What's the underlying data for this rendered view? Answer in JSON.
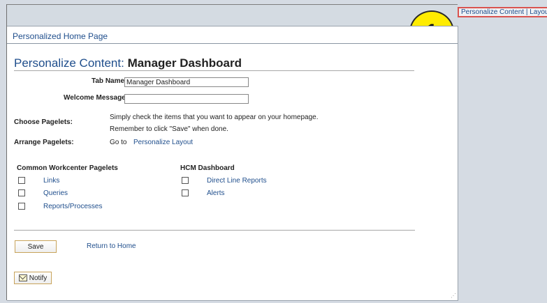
{
  "top_right": {
    "personalize_content": "Personalize Content",
    "separator": "|",
    "layout": "Layout"
  },
  "callout": {
    "number": "1"
  },
  "home": {
    "title": "Personalized Home Page"
  },
  "page": {
    "title_prefix": "Personalize Content:",
    "title_name": "Manager Dashboard"
  },
  "form": {
    "tab_name_label": "Tab Name",
    "tab_name_value": "Manager Dashboard",
    "welcome_label": "Welcome Message",
    "welcome_value": "",
    "choose_label": "Choose Pagelets:",
    "choose_text_1": "Simply check the items that you want to appear on your homepage.",
    "choose_text_2": "Remember to click \"Save\" when done.",
    "arrange_label": "Arrange Pagelets:",
    "goto_text": "Go to",
    "personalize_layout_link": "Personalize Layout"
  },
  "groups": {
    "common": {
      "title": "Common Workcenter Pagelets",
      "items": [
        "Links",
        "Queries",
        "Reports/Processes"
      ]
    },
    "hcm": {
      "title": "HCM Dashboard",
      "items": [
        "Direct Line Reports",
        "Alerts"
      ]
    }
  },
  "actions": {
    "save": "Save",
    "return_home": "Return to Home",
    "notify": "Notify"
  }
}
